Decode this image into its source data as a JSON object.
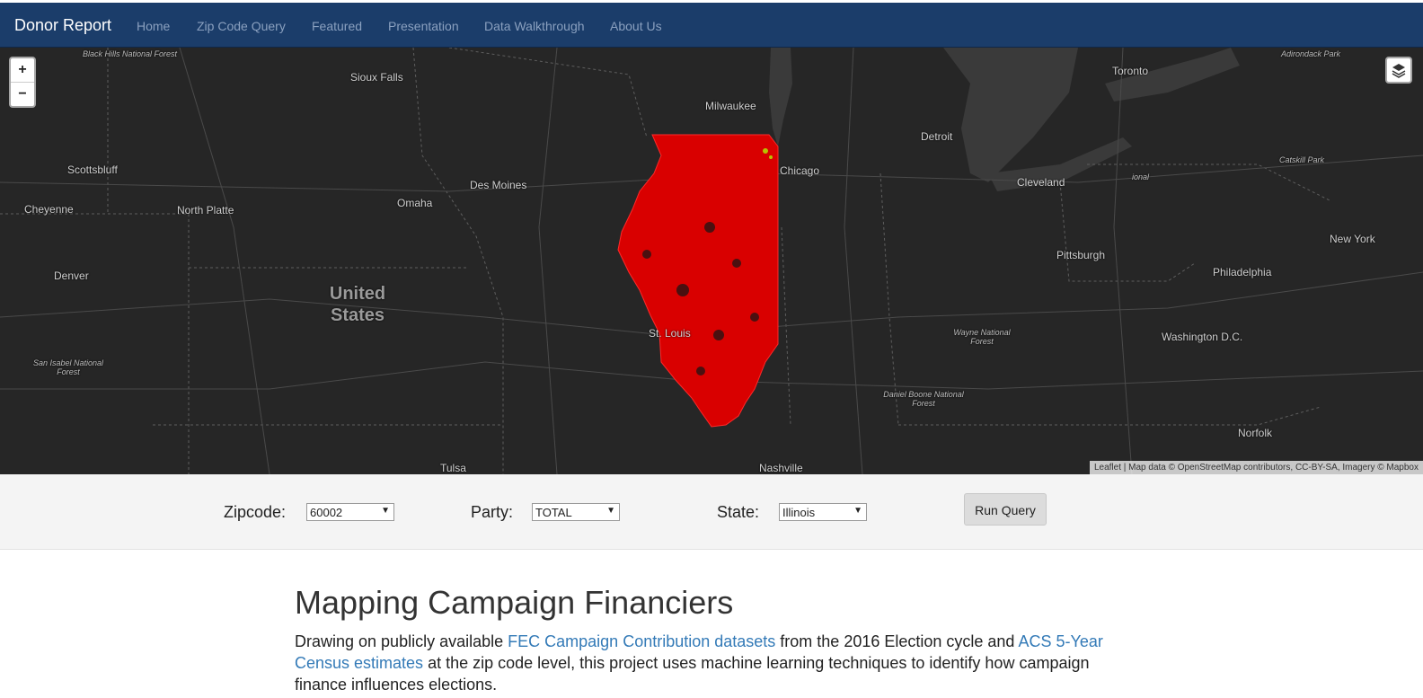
{
  "navbar": {
    "brand": "Donor Report",
    "links": [
      "Home",
      "Zip Code Query",
      "Featured",
      "Presentation",
      "Data Walkthrough",
      "About Us"
    ]
  },
  "map": {
    "zoom_in": "+",
    "zoom_out": "−",
    "layers_icon": "layers-icon",
    "choropleth_color": "#d90000",
    "labels": {
      "black_hills": "Black Hills National Forest",
      "sioux_falls": "Sioux Falls",
      "milwaukee": "Milwaukee",
      "toronto": "Toronto",
      "adirondack": "Adirondack Park",
      "scottsbluff": "Scottsbluff",
      "des_moines": "Des Moines",
      "detroit": "Detroit",
      "chicago": "Chicago",
      "catskill": "Catskill Park",
      "cheyenne": "Cheyenne",
      "north_platte": "North Platte",
      "omaha": "Omaha",
      "cleveland": "Cleveland",
      "national": "ional",
      "new_york": "New York",
      "denver": "Denver",
      "united_states": "United States",
      "pittsburgh": "Pittsburgh",
      "philadelphia": "Philadelphia",
      "st_louis": "St. Louis",
      "wayne": "Wayne National Forest",
      "washington": "Washington D.C.",
      "san_isabel": "San Isabel National Forest",
      "daniel_boone": "Daniel Boone National Forest",
      "norfolk": "Norfolk",
      "tulsa": "Tulsa",
      "nashville": "Nashville"
    },
    "attribution": "Leaflet | Map data © OpenStreetMap contributors, CC-BY-SA, Imagery © Mapbox"
  },
  "query": {
    "zipcode_label": "Zipcode:",
    "zipcode_value": "60002",
    "party_label": "Party:",
    "party_value": "TOTAL",
    "state_label": "State:",
    "state_value": "Illinois",
    "run_button": "Run Query"
  },
  "content": {
    "title": "Mapping Campaign Financiers",
    "p_1": "Drawing on publicly available ",
    "link_fec": "FEC Campaign Contribution datasets",
    "p_2": " from the 2016 Election cycle and ",
    "link_acs": "ACS 5-Year Census estimates",
    "p_3": " at the zip code level, this project uses machine learning techniques to identify how campaign finance influences elections."
  }
}
